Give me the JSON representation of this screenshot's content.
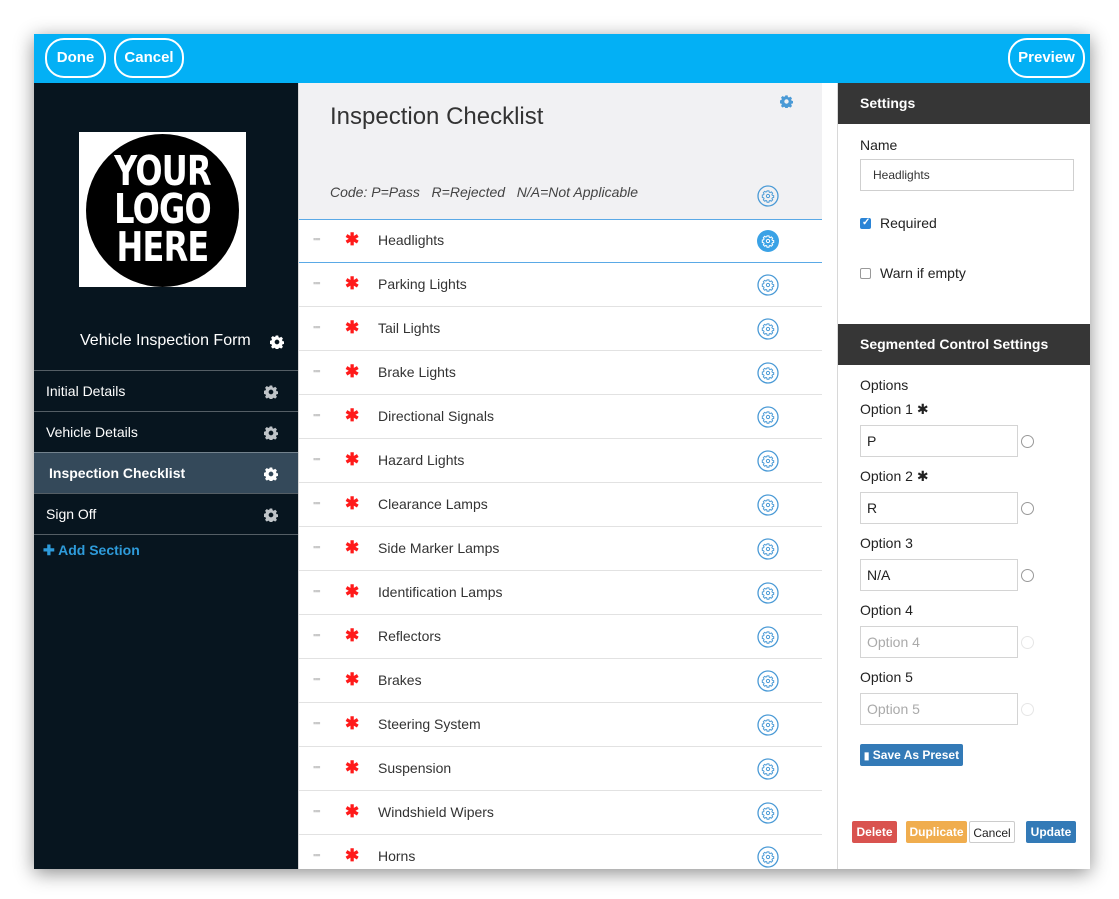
{
  "topbar": {
    "done": "Done",
    "cancel": "Cancel",
    "preview": "Preview"
  },
  "sidebar": {
    "logo_text": [
      "YOUR",
      "LOGO",
      "HERE"
    ],
    "form_title": "Vehicle Inspection Form",
    "sections": [
      {
        "label": "Initial Details",
        "active": false
      },
      {
        "label": "Vehicle Details",
        "active": false
      },
      {
        "label": "Inspection Checklist",
        "active": true
      },
      {
        "label": "Sign Off",
        "active": false
      }
    ],
    "add_section": "Add Section"
  },
  "main": {
    "title": "Inspection Checklist",
    "codes": "Code: P=Pass   R=Rejected   N/A=Not Applicable",
    "items": [
      "Headlights",
      "Parking Lights",
      "Tail Lights",
      "Brake Lights",
      "Directional Signals",
      "Hazard Lights",
      "Clearance Lamps",
      "Side Marker Lamps",
      "Identification Lamps",
      "Reflectors",
      "Brakes",
      "Steering System",
      "Suspension",
      "Windshield Wipers",
      "Horns"
    ],
    "selected_item": "Headlights"
  },
  "settings": {
    "header": "Settings",
    "name_label": "Name",
    "name_value": "Headlights",
    "required_label": "Required",
    "required_checked": true,
    "warn_label": "Warn if empty",
    "warn_checked": false
  },
  "segmented": {
    "header": "Segmented Control Settings",
    "options_label": "Options",
    "options": [
      {
        "label": "Option 1",
        "required": true,
        "value": "P",
        "placeholder": ""
      },
      {
        "label": "Option 2",
        "required": true,
        "value": "R",
        "placeholder": ""
      },
      {
        "label": "Option 3",
        "required": false,
        "value": "N/A",
        "placeholder": ""
      },
      {
        "label": "Option 4",
        "required": false,
        "value": "",
        "placeholder": "Option 4"
      },
      {
        "label": "Option 5",
        "required": false,
        "value": "",
        "placeholder": "Option 5"
      }
    ],
    "save_preset": "Save As Preset"
  },
  "actions": {
    "delete": "Delete",
    "duplicate": "Duplicate",
    "cancel": "Cancel",
    "update": "Update"
  },
  "colors": {
    "topbar": "#03b0f5",
    "sidebar": "#07151f",
    "active_section": "#34495a",
    "required": "#ff1a1a",
    "gear": "#4a9ad6",
    "delete": "#d9534f",
    "duplicate": "#f0ad4e",
    "update": "#337ab7"
  }
}
